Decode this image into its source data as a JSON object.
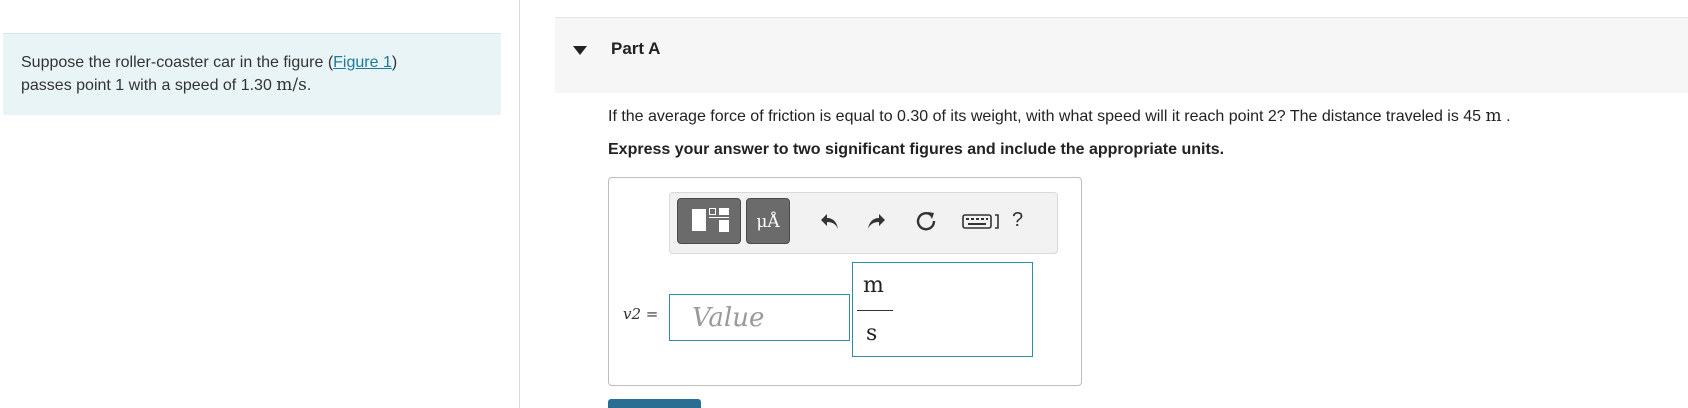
{
  "intro": {
    "text_before_link": "Suppose the roller-coaster car in the figure (",
    "link_text": "Figure 1",
    "text_after_link": ")",
    "line2": "passes point 1 with a speed of 1.30 ",
    "speed_units": "m/s",
    "period": "."
  },
  "part": {
    "title": "Part A",
    "question_text": "If the average force of friction is equal to 0.30 of its weight, with what speed will it reach point 2? The distance traveled is 45 ",
    "distance_unit": "m",
    "question_end": " .",
    "instruction": "Express your answer to two significant figures and include the appropriate units."
  },
  "toolbar": {
    "units_label": "μÅ",
    "help_label": "?",
    "icons": [
      "templates-icon",
      "units-icon",
      "undo-icon",
      "redo-icon",
      "reset-icon",
      "keyboard-icon",
      "help-icon"
    ]
  },
  "answer": {
    "variable_label": "v2 =",
    "value_placeholder": "Value",
    "unit_numerator": "m",
    "unit_denominator": "s"
  },
  "colors": {
    "intro_bg": "#e8f4f6",
    "link": "#1e7a9c",
    "input_border": "#2f8ba6",
    "toolbar_button": "#6b6b6b",
    "submit": "#2a6f93"
  }
}
